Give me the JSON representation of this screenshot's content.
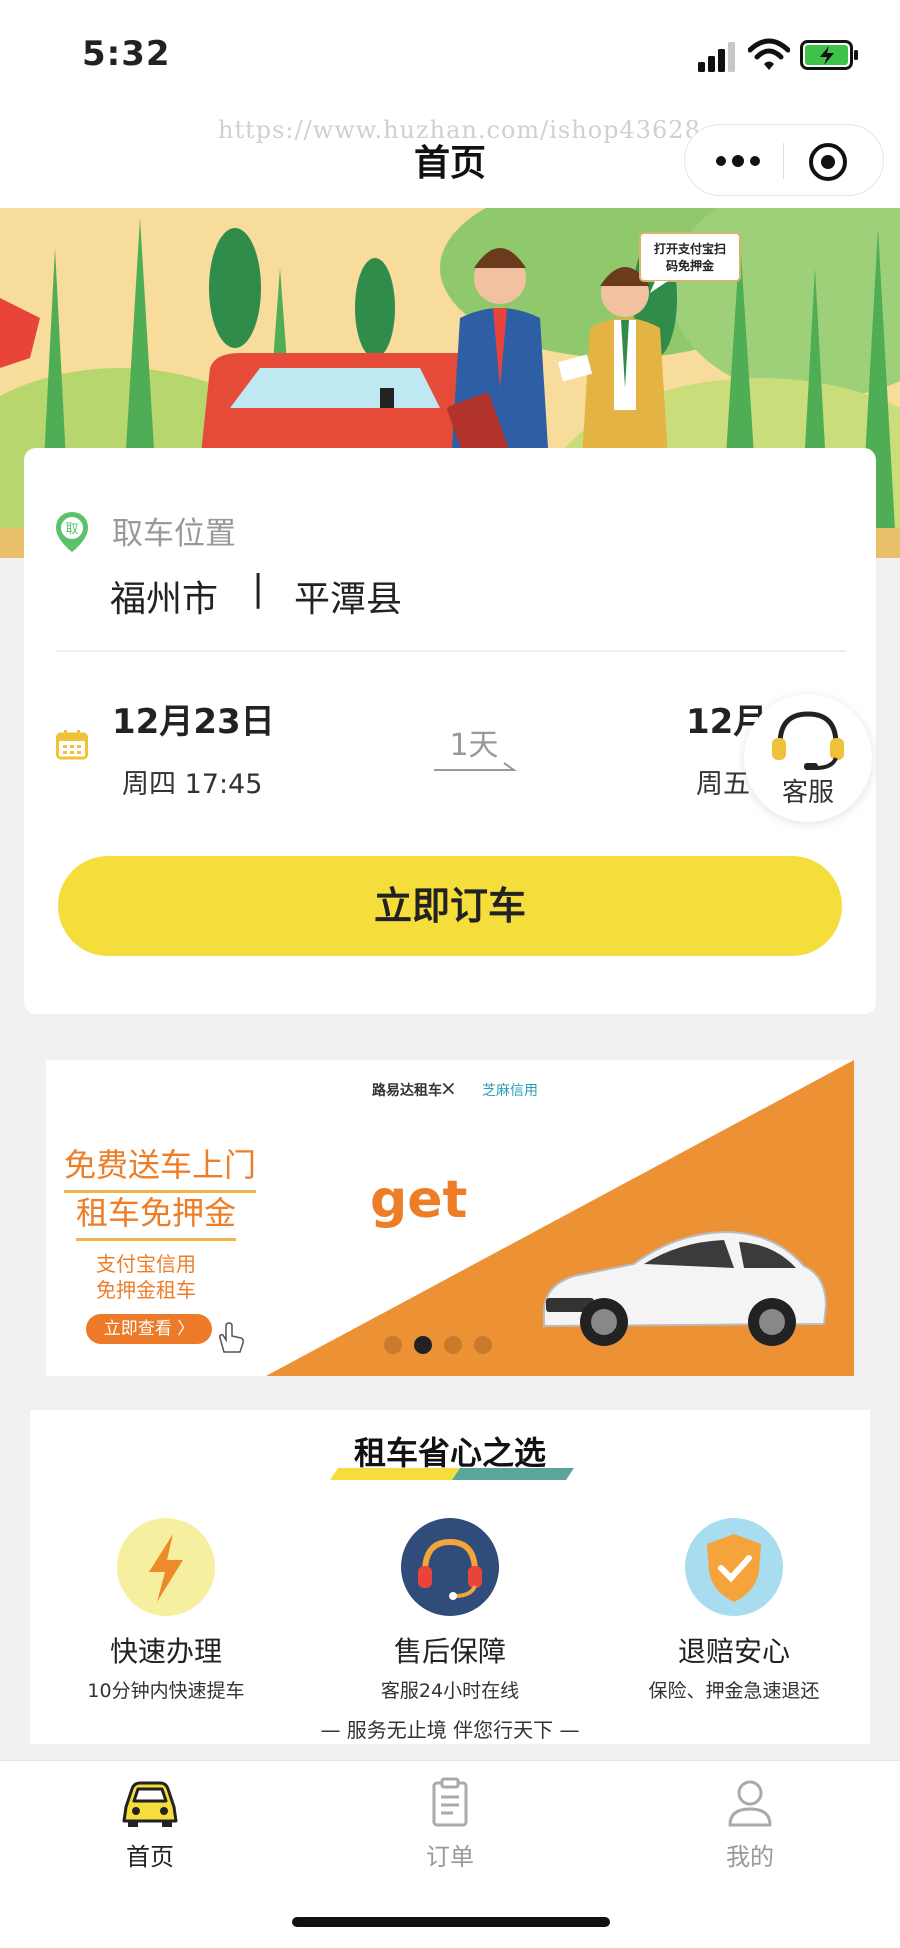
{
  "status_bar": {
    "time": "5:32"
  },
  "nav": {
    "watermark": "https://www.huzhan.com/ishop43628",
    "title": "首页"
  },
  "hero": {
    "bubble_line1": "打开支付宝扫",
    "bubble_line2": "码免押金"
  },
  "booking": {
    "pickup_label": "取车位置",
    "pin_text": "取",
    "city": "福州市",
    "separator": "|",
    "county": "平潭县",
    "pickup_date": "12月23日",
    "pickup_week_time": "周四  17:45",
    "duration": "1天",
    "return_date": "12月2",
    "return_week": "周五",
    "book_button": "立即订车"
  },
  "customer_service": {
    "label": "客服"
  },
  "promo": {
    "brand1": "路易达租车",
    "brand_x": "×",
    "brand2": "芝麻信用",
    "headline1": "免费送车上门",
    "headline2": "租车免押金",
    "sub1": "支付宝信用",
    "sub2": "免押金租车",
    "cta": "立即查看 〉",
    "get_text": "get",
    "active_dot": 1
  },
  "features": {
    "title": "租车省心之选",
    "items": [
      {
        "name": "快速办理",
        "desc": "10分钟内快速提车",
        "icon": "lightning-icon",
        "color": "#f7efa0"
      },
      {
        "name": "售后保障",
        "desc": "客服24小时在线",
        "icon": "headset-icon",
        "color": "#2f4c7a"
      },
      {
        "name": "退赔安心",
        "desc": "保险、押金急速退还",
        "icon": "shield-icon",
        "color": "#a8dcef"
      }
    ],
    "slogan": "— 服务无止境 伴您行天下 —"
  },
  "tabbar": {
    "items": [
      {
        "label": "首页",
        "icon": "car-icon",
        "active": true
      },
      {
        "label": "订单",
        "icon": "clipboard-icon",
        "active": false
      },
      {
        "label": "我的",
        "icon": "user-icon",
        "active": false
      }
    ]
  },
  "colors": {
    "accent": "#f5dd3c",
    "promo_orange": "#ee7d28"
  }
}
